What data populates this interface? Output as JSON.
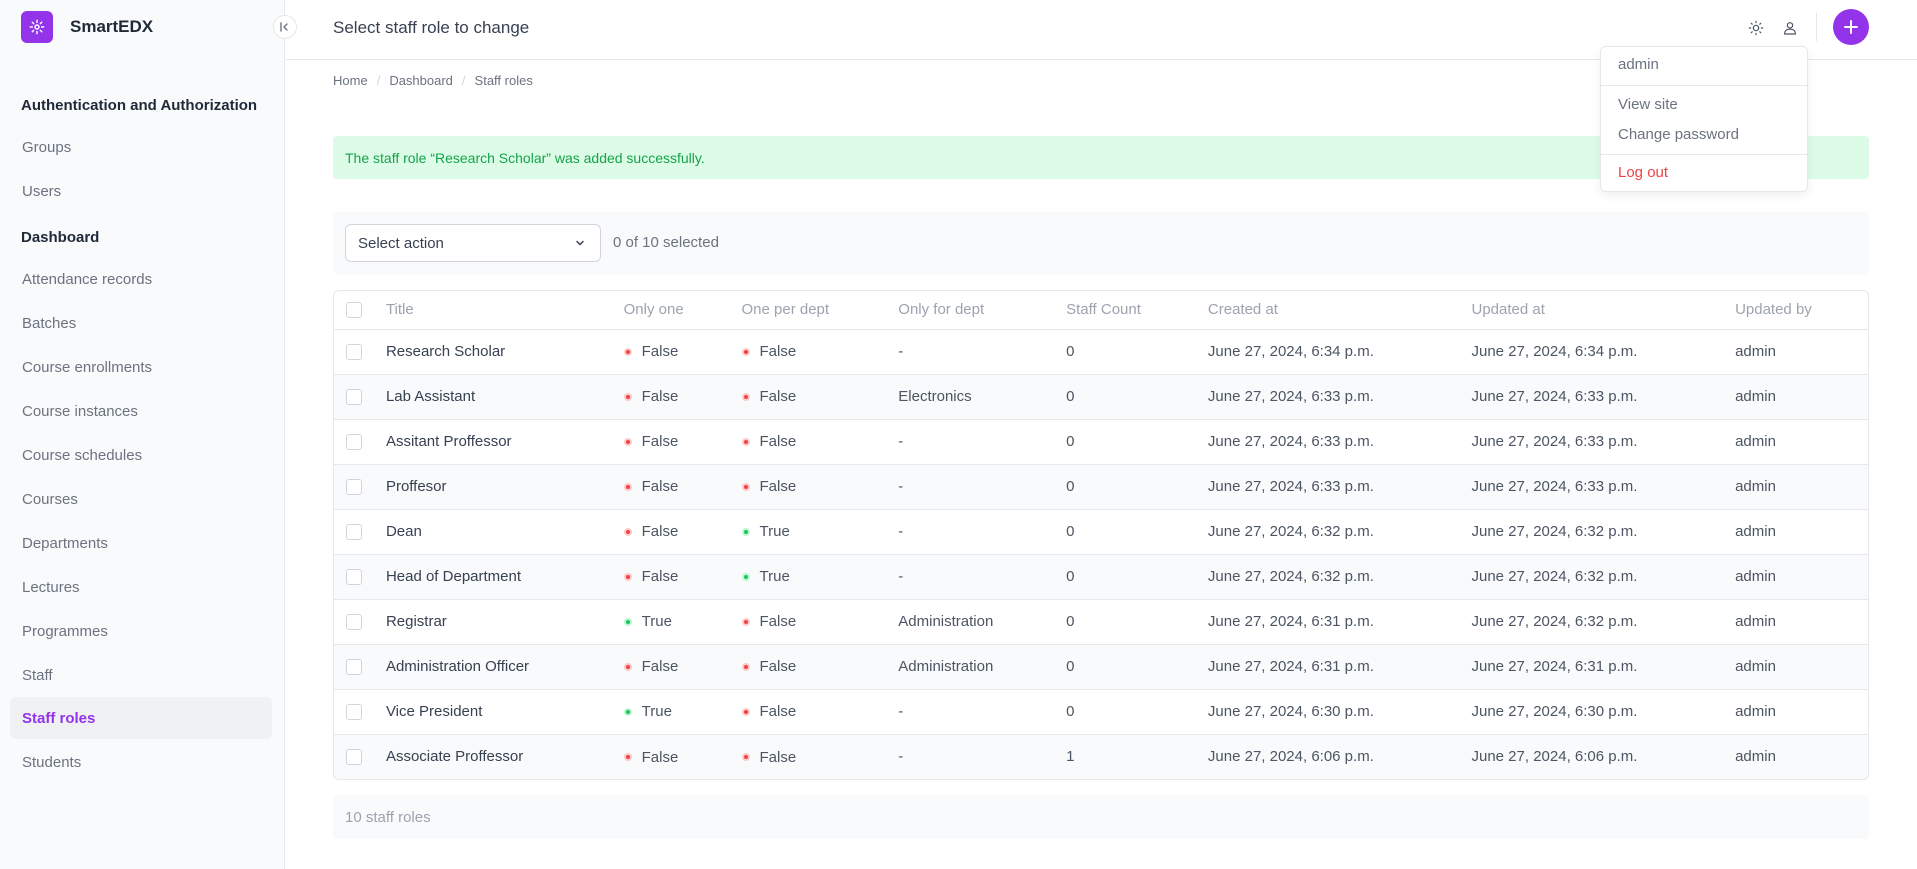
{
  "brand": {
    "name": "SmartEDX"
  },
  "header": {
    "title": "Select staff role to change"
  },
  "breadcrumb": [
    "Home",
    "Dashboard",
    "Staff roles"
  ],
  "sidebar": {
    "sections": [
      {
        "title": "Authentication and Authorization",
        "items": [
          "Groups",
          "Users"
        ]
      },
      {
        "title": "Dashboard",
        "items": [
          "Attendance records",
          "Batches",
          "Course enrollments",
          "Course instances",
          "Course schedules",
          "Courses",
          "Departments",
          "Lectures",
          "Programmes",
          "Staff",
          "Staff roles",
          "Students"
        ]
      }
    ],
    "active": "Staff roles"
  },
  "message": "The staff role “Research Scholar” was added successfully.",
  "actions": {
    "select_placeholder": "Select action",
    "selected_count": "0 of 10 selected"
  },
  "table": {
    "columns": [
      "Title",
      "Only one",
      "One per dept",
      "Only for dept",
      "Staff Count",
      "Created at",
      "Updated at",
      "Updated by"
    ],
    "rows": [
      {
        "title": "Research Scholar",
        "only_one": "False",
        "one_per_dept": "False",
        "only_for_dept": "-",
        "staff_count": "0",
        "created_at": "June 27, 2024, 6:34 p.m.",
        "updated_at": "June 27, 2024, 6:34 p.m.",
        "updated_by": "admin"
      },
      {
        "title": "Lab Assistant",
        "only_one": "False",
        "one_per_dept": "False",
        "only_for_dept": "Electronics",
        "staff_count": "0",
        "created_at": "June 27, 2024, 6:33 p.m.",
        "updated_at": "June 27, 2024, 6:33 p.m.",
        "updated_by": "admin"
      },
      {
        "title": "Assitant Proffessor",
        "only_one": "False",
        "one_per_dept": "False",
        "only_for_dept": "-",
        "staff_count": "0",
        "created_at": "June 27, 2024, 6:33 p.m.",
        "updated_at": "June 27, 2024, 6:33 p.m.",
        "updated_by": "admin"
      },
      {
        "title": "Proffesor",
        "only_one": "False",
        "one_per_dept": "False",
        "only_for_dept": "-",
        "staff_count": "0",
        "created_at": "June 27, 2024, 6:33 p.m.",
        "updated_at": "June 27, 2024, 6:33 p.m.",
        "updated_by": "admin"
      },
      {
        "title": "Dean",
        "only_one": "False",
        "one_per_dept": "True",
        "only_for_dept": "-",
        "staff_count": "0",
        "created_at": "June 27, 2024, 6:32 p.m.",
        "updated_at": "June 27, 2024, 6:32 p.m.",
        "updated_by": "admin"
      },
      {
        "title": "Head of Department",
        "only_one": "False",
        "one_per_dept": "True",
        "only_for_dept": "-",
        "staff_count": "0",
        "created_at": "June 27, 2024, 6:32 p.m.",
        "updated_at": "June 27, 2024, 6:32 p.m.",
        "updated_by": "admin"
      },
      {
        "title": "Registrar",
        "only_one": "True",
        "one_per_dept": "False",
        "only_for_dept": "Administration",
        "staff_count": "0",
        "created_at": "June 27, 2024, 6:31 p.m.",
        "updated_at": "June 27, 2024, 6:32 p.m.",
        "updated_by": "admin"
      },
      {
        "title": "Administration Officer",
        "only_one": "False",
        "one_per_dept": "False",
        "only_for_dept": "Administration",
        "staff_count": "0",
        "created_at": "June 27, 2024, 6:31 p.m.",
        "updated_at": "June 27, 2024, 6:31 p.m.",
        "updated_by": "admin"
      },
      {
        "title": "Vice President",
        "only_one": "True",
        "one_per_dept": "False",
        "only_for_dept": "-",
        "staff_count": "0",
        "created_at": "June 27, 2024, 6:30 p.m.",
        "updated_at": "June 27, 2024, 6:30 p.m.",
        "updated_by": "admin"
      },
      {
        "title": "Associate Proffessor",
        "only_one": "False",
        "one_per_dept": "False",
        "only_for_dept": "-",
        "staff_count": "1",
        "created_at": "June 27, 2024, 6:06 p.m.",
        "updated_at": "June 27, 2024, 6:06 p.m.",
        "updated_by": "admin"
      }
    ]
  },
  "paginator": "10 staff roles",
  "user_menu": {
    "username": "admin",
    "items": [
      "View site",
      "Change password"
    ],
    "logout": "Log out"
  },
  "colors": {
    "accent": "#9333ea",
    "success_bg": "#dcfce7",
    "success_text": "#16a34a",
    "false_dot": "#ef4444",
    "true_dot": "#22c55e",
    "logout": "#ef4444"
  },
  "icons": {
    "brand": "gear-icon",
    "collapse": "collapse-sidebar-icon",
    "theme": "sun-icon",
    "user": "user-icon",
    "add": "plus-icon",
    "select": "chevron-down-icon"
  }
}
